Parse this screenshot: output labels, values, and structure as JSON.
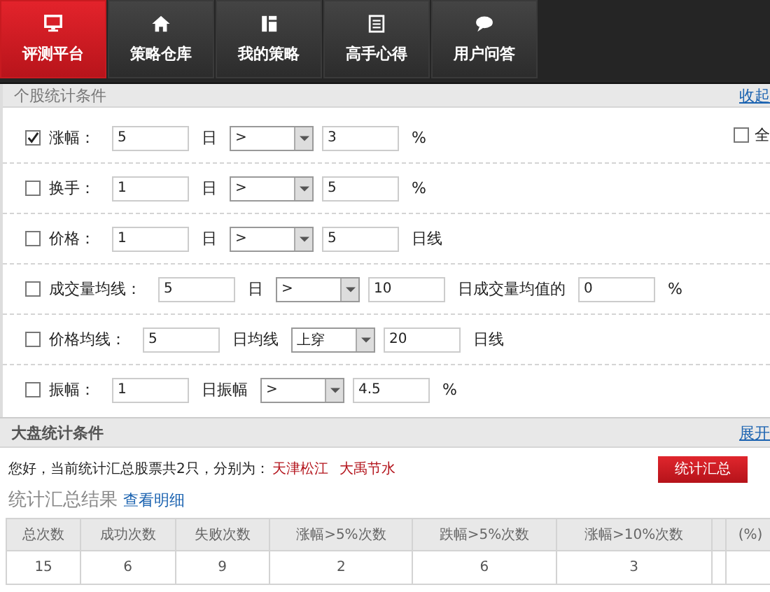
{
  "nav": {
    "tabs": [
      {
        "label": "评测平台",
        "selected": true
      },
      {
        "label": "策略仓库",
        "selected": false
      },
      {
        "label": "我的策略",
        "selected": false
      },
      {
        "label": "高手心得",
        "selected": false
      },
      {
        "label": "用户问答",
        "selected": false
      }
    ]
  },
  "stock_conditions": {
    "title": "个股统计条件",
    "toggle_link": "收起",
    "select_all": {
      "label": "全",
      "checked": false
    },
    "rows": [
      {
        "checked": true,
        "parts": [
          {
            "kind": "label",
            "text": "涨幅："
          },
          {
            "kind": "input",
            "value": "5"
          },
          {
            "kind": "text",
            "text": "日"
          },
          {
            "kind": "select",
            "value": ">"
          },
          {
            "kind": "input",
            "value": "3"
          },
          {
            "kind": "text",
            "text": "%"
          }
        ]
      },
      {
        "checked": false,
        "parts": [
          {
            "kind": "label",
            "text": "换手："
          },
          {
            "kind": "input",
            "value": "1"
          },
          {
            "kind": "text",
            "text": "日"
          },
          {
            "kind": "select",
            "value": ">"
          },
          {
            "kind": "input",
            "value": "5"
          },
          {
            "kind": "text",
            "text": "%"
          }
        ]
      },
      {
        "checked": false,
        "parts": [
          {
            "kind": "label",
            "text": "价格："
          },
          {
            "kind": "input",
            "value": "1"
          },
          {
            "kind": "text",
            "text": "日"
          },
          {
            "kind": "select",
            "value": ">"
          },
          {
            "kind": "input",
            "value": "5"
          },
          {
            "kind": "text",
            "text": "日线"
          }
        ]
      },
      {
        "checked": false,
        "parts": [
          {
            "kind": "label",
            "text": "成交量均线："
          },
          {
            "kind": "input",
            "value": "5"
          },
          {
            "kind": "text",
            "text": "日"
          },
          {
            "kind": "select",
            "value": ">"
          },
          {
            "kind": "input",
            "value": "10"
          },
          {
            "kind": "text",
            "text": "日成交量均值的"
          },
          {
            "kind": "input",
            "value": "0"
          },
          {
            "kind": "text",
            "text": "%"
          }
        ]
      },
      {
        "checked": false,
        "parts": [
          {
            "kind": "label",
            "text": "价格均线："
          },
          {
            "kind": "input",
            "value": "5"
          },
          {
            "kind": "text",
            "text": "日均线"
          },
          {
            "kind": "select",
            "value": "上穿"
          },
          {
            "kind": "input",
            "value": "20"
          },
          {
            "kind": "text",
            "text": "日线"
          }
        ]
      },
      {
        "checked": false,
        "parts": [
          {
            "kind": "label",
            "text": "振幅："
          },
          {
            "kind": "input",
            "value": "1"
          },
          {
            "kind": "text",
            "text": "日振幅"
          },
          {
            "kind": "select",
            "value": ">"
          },
          {
            "kind": "input",
            "value": "4.5"
          },
          {
            "kind": "text",
            "text": "%"
          }
        ]
      }
    ]
  },
  "market_conditions": {
    "title": "大盘统计条件",
    "toggle_link": "展开"
  },
  "summary": {
    "message": "您好，当前统计汇总股票共2只，分别为：",
    "stocks": [
      "天津松江",
      "大禹节水"
    ],
    "button": "统计汇总",
    "results_title": "统计汇总结果",
    "details_link": "查看明细",
    "table": {
      "columns": [
        "总次数",
        "成功次数",
        "失败次数",
        "涨幅>5%次数",
        "跌幅>5%次数",
        "涨幅>10%次数",
        null,
        "(%)"
      ],
      "rows": [
        [
          "15",
          "6",
          "9",
          "2",
          "6",
          "3",
          null,
          null
        ]
      ]
    }
  }
}
